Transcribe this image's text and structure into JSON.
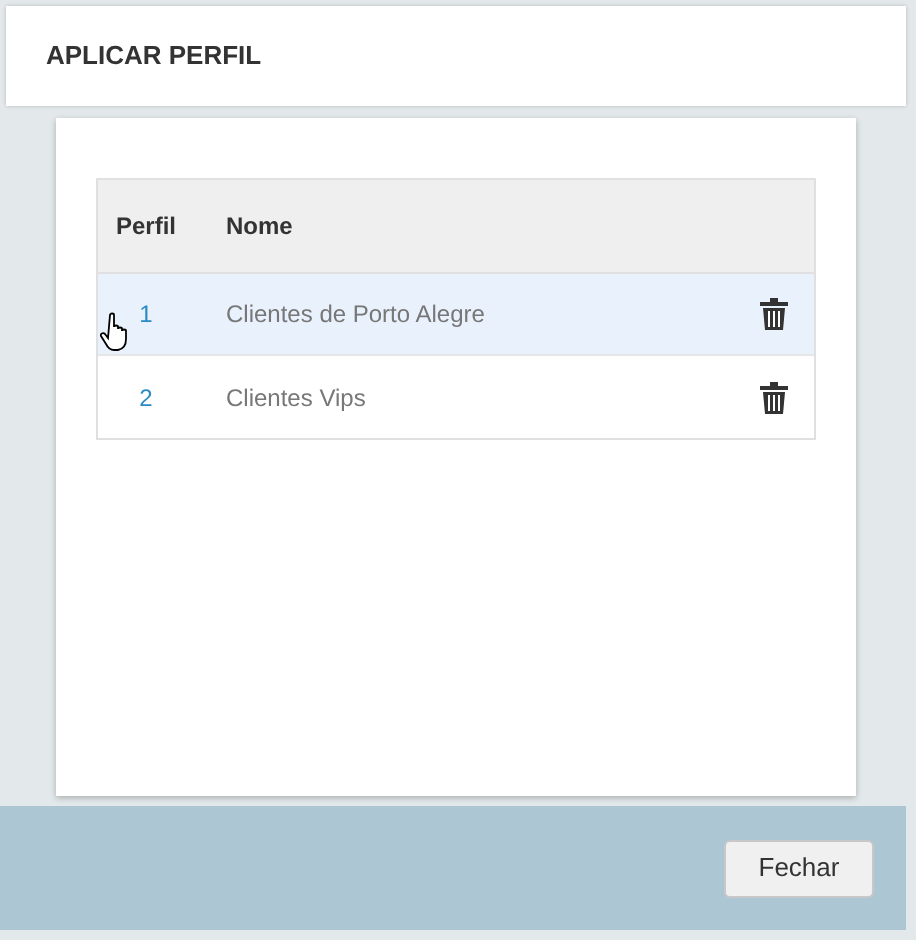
{
  "dialog": {
    "title": "APLICAR PERFIL"
  },
  "table": {
    "columns": [
      "Perfil",
      "Nome"
    ],
    "rows": [
      {
        "perfil": "1",
        "nome": "Clientes de Porto Alegre",
        "highlighted": true
      },
      {
        "perfil": "2",
        "nome": "Clientes Vips",
        "highlighted": false
      }
    ]
  },
  "buttons": [
    "Fechar"
  ]
}
